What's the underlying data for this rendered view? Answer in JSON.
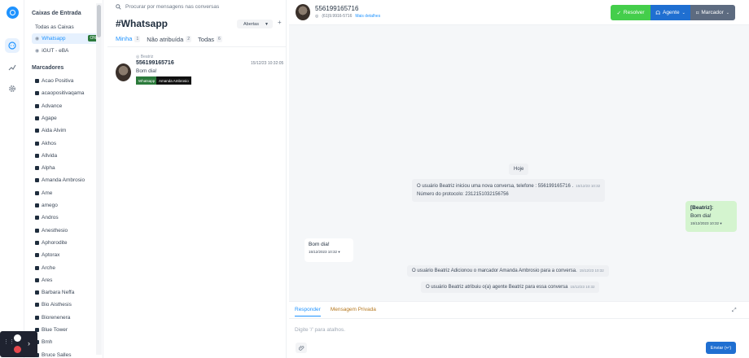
{
  "sidebar": {
    "inboxes_title": "Caixas de Entrada",
    "inboxes": [
      {
        "label": "Todas as Caixas"
      },
      {
        "label": "Whatsapp",
        "badge": "ON"
      },
      {
        "label": "iGUT - eBA"
      }
    ],
    "labels_title": "Marcadores",
    "labels": [
      "Acao Positiva",
      "acaopositivaqama",
      "Advance",
      "Agape",
      "Aida Alvim",
      "Akhos",
      "Allvida",
      "Alpha",
      "Amanda Ambrosio",
      "Ame",
      "amego",
      "Andros",
      "Anesthesio",
      "Aphorodite",
      "Aptorax",
      "Arche",
      "Ares",
      "Barbara Neffa",
      "Bio Aisthesis",
      "Biorenenera",
      "Blue Tower",
      "Bmh",
      "Bruce Salles"
    ]
  },
  "conversation_list": {
    "search_placeholder": "Procurar por mensagens nas conversas",
    "title": "#Whatsapp",
    "status_filter": "Abertas",
    "tabs": [
      {
        "label": "Minha",
        "count": "1"
      },
      {
        "label": "Não atribuída",
        "count": "2"
      },
      {
        "label": "Todas",
        "count": "6"
      }
    ],
    "items": [
      {
        "inbox": "Beatriz",
        "phone": "556199165716",
        "time": "15/12/23 10:32:05",
        "message": "Bom dia!",
        "tags": [
          {
            "label": "Whatsapp",
            "color": "#2b7a3b"
          },
          {
            "label": "Amanda Ambrosio",
            "color": "#111111"
          }
        ]
      }
    ]
  },
  "chat": {
    "contact_name": "556199165716",
    "contact_phone": "(61)9.9916-5716",
    "details_link": "Mais detalhes",
    "buttons": {
      "resolve": "Resolver",
      "agent": "Agente",
      "label": "Marcador"
    },
    "date_divider": "Hoje",
    "activity_1": {
      "line1": "O usuário Beatriz iniciou uma nova conversa, telefone : 556199165716 .",
      "line2": "Número do protocolo: 2312151032156756",
      "time": "15/12/23 10:32"
    },
    "outgoing": {
      "sender": "[Beatriz]:",
      "text": "Bom dia!",
      "time": "15/12/2023 10:32"
    },
    "incoming": {
      "text": "Bom dia!",
      "time": "15/12/2023 10:32"
    },
    "activity_2": {
      "text": "O usuário Beatriz Adicionou o marcador Amanda Ambrosio para a conversa.",
      "time": "15/12/23 10:32"
    },
    "activity_3": {
      "text": "O usuário Beatriz atribuiu o(a) agente Beatriz para essa conversa",
      "time": "15/12/23 10:32"
    }
  },
  "reply": {
    "tab_reply": "Responder",
    "tab_private": "Mensagem Privada",
    "placeholder": "Digite '/' para atalhos.",
    "send": "Enviar (↵)"
  },
  "colors": {
    "accent": "#1f93ff",
    "resolve": "#44ce4b",
    "agent": "#1f6fd1",
    "label_btn": "#5d6b80"
  }
}
